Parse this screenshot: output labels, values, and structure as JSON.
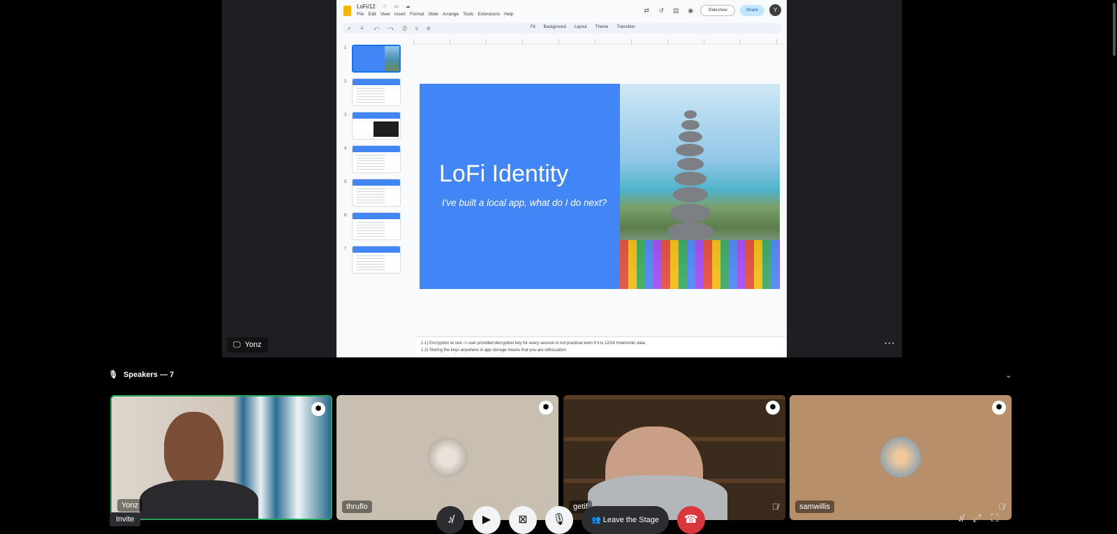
{
  "slides_app": {
    "doc_title": "LoFi/12",
    "menus": [
      "File",
      "Edit",
      "View",
      "Insert",
      "Format",
      "Slide",
      "Arrange",
      "Tools",
      "Extensions",
      "Help"
    ],
    "slideshow_label": "Slideshow",
    "share_label": "Share",
    "user_initial": "Y",
    "toolbar_labels": [
      "Fit",
      "Background",
      "Layout",
      "Theme",
      "Transition"
    ],
    "slide_numbers": [
      "1",
      "2",
      "3",
      "4",
      "5",
      "6",
      "7"
    ],
    "current_slide": {
      "title": "LoFi Identity",
      "subtitle": "I've built a local app, what do I do next?"
    },
    "speaker_notes": [
      "1.1) Encryption at rest -> user provided decryption key for every session is not practical even if it is 12/24 mnemonic data.",
      "1.2) Storing the keys anywhere in app storage means that you are obfuscation"
    ]
  },
  "stage": {
    "presenter_name": "Yonz"
  },
  "speakers": {
    "label": "Speakers — 7",
    "participants": [
      {
        "name": "Yonz"
      },
      {
        "name": "thruflo"
      },
      {
        "name": "getif"
      },
      {
        "name": "samwillis"
      }
    ]
  },
  "controls": {
    "invite_label": "Invite",
    "leave_label": "Leave the Stage"
  },
  "colors": {
    "slide_blue": "#4285f4",
    "speaking_green": "#23a559",
    "hangup_red": "#da373c"
  }
}
